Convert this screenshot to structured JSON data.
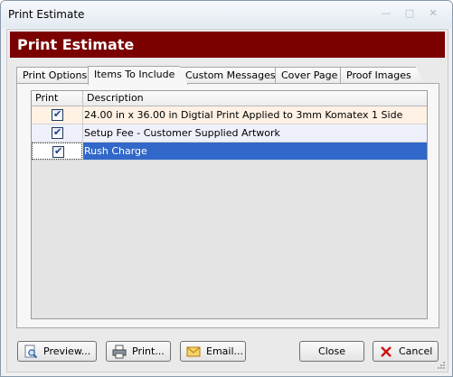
{
  "window": {
    "title": "Print Estimate"
  },
  "header": {
    "title": "Print Estimate"
  },
  "tabs": [
    {
      "label": "Print Options"
    },
    {
      "label": "Items To Include"
    },
    {
      "label": "Custom Messages"
    },
    {
      "label": "Cover Page"
    },
    {
      "label": "Proof Images"
    }
  ],
  "active_tab": "Items To Include",
  "grid": {
    "columns": {
      "print": "Print",
      "description": "Description"
    },
    "rows": [
      {
        "checked": true,
        "description": "24.00 in x 36.00 in Digtial Print Applied to 3mm Komatex 1 Side"
      },
      {
        "checked": true,
        "description": "Setup Fee - Customer Supplied Artwork"
      },
      {
        "checked": true,
        "description": "Rush Charge",
        "selected": true
      }
    ]
  },
  "buttons": {
    "preview": "Preview...",
    "print": "Print...",
    "email": "Email...",
    "close": "Close",
    "cancel": "Cancel"
  },
  "colors": {
    "header_bg": "#7b0000",
    "selection": "#3168c9"
  }
}
